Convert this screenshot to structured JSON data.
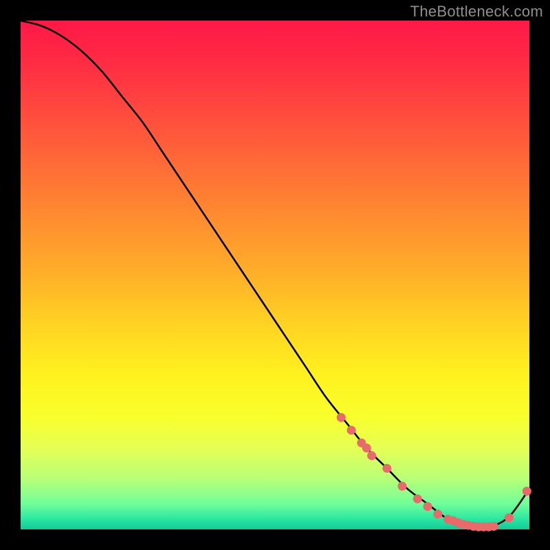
{
  "watermark": "TheBottleneck.com",
  "colors": {
    "background": "#000000",
    "curve_stroke": "#000000",
    "point_fill": "#e86a6a",
    "gradient_top": "#ff1846",
    "gradient_bottom": "#12c99a"
  },
  "chart_data": {
    "type": "line",
    "title": "",
    "xlabel": "",
    "ylabel": "",
    "xlim": [
      0,
      100
    ],
    "ylim": [
      0,
      100
    ],
    "grid": false,
    "legend": false,
    "series": [
      {
        "name": "bottleneck-curve",
        "x": [
          0,
          4,
          8,
          12,
          16,
          20,
          24,
          28,
          32,
          36,
          40,
          44,
          48,
          52,
          56,
          60,
          64,
          68,
          72,
          76,
          80,
          84,
          88,
          92,
          96,
          100
        ],
        "values": [
          100,
          99,
          97,
          94,
          90,
          85,
          80,
          74,
          68,
          62,
          56,
          50,
          44,
          38,
          32,
          26,
          21,
          16,
          12,
          8,
          5,
          2,
          0.5,
          0.5,
          2.5,
          8
        ]
      }
    ],
    "segment_points": {
      "name": "highlighted-points",
      "x": [
        63,
        65,
        67,
        68,
        69,
        72,
        75,
        78,
        80,
        82,
        84,
        85,
        86,
        87,
        88,
        89,
        90,
        91,
        92,
        93,
        96,
        99.5
      ],
      "values": [
        22,
        19.5,
        17,
        16,
        14.5,
        12,
        8.5,
        6,
        4.5,
        3,
        2,
        1.7,
        1.3,
        1.0,
        0.8,
        0.6,
        0.5,
        0.5,
        0.5,
        0.6,
        2.3,
        7.5
      ]
    }
  }
}
